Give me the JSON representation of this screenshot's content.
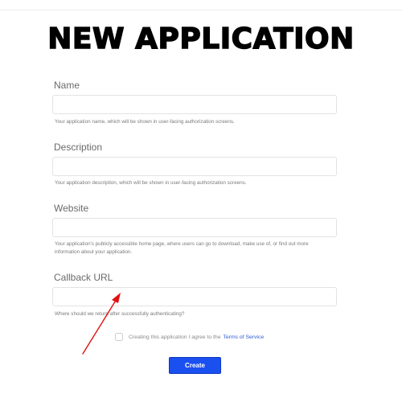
{
  "page": {
    "title": "NEW APPLICATION"
  },
  "form": {
    "name": {
      "label": "Name",
      "value": "",
      "help": "Your application name, which will be shown in user-facing authorization screens."
    },
    "description": {
      "label": "Description",
      "value": "",
      "help": "Your application description, which will be shown in user-facing authorization screens."
    },
    "website": {
      "label": "Website",
      "value": "",
      "help": "Your application's publicly accessible home page, where users can go to download, make use of, or find out more information about your application."
    },
    "callback": {
      "label": "Callback URL",
      "value": "",
      "help": "Where should we return after successfully authenticating?"
    },
    "terms": {
      "text": "Creating this application I agree to the",
      "link": "Terms of Service",
      "checked": false
    },
    "create_label": "Create"
  },
  "annotation": {
    "arrow_color": "#e01010"
  },
  "colors": {
    "primary_button": "#1a4ff0",
    "link": "#2a5bd7"
  }
}
